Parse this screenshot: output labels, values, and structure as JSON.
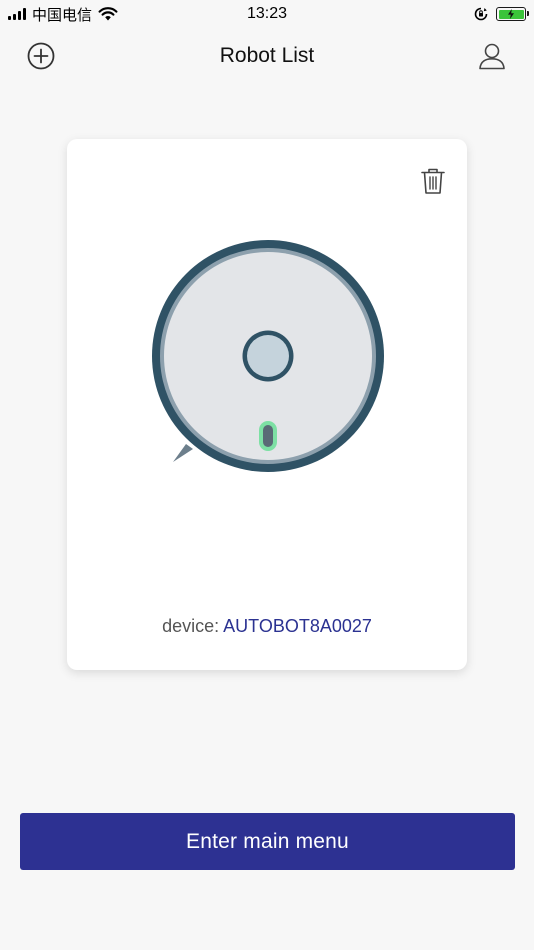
{
  "status_bar": {
    "carrier": "中国电信",
    "time": "13:23",
    "battery_color": "#3bc43a"
  },
  "nav": {
    "title": "Robot List",
    "add_icon": "plus-circle-icon",
    "profile_icon": "user-icon"
  },
  "robot_card": {
    "delete_icon": "trash-icon",
    "device_label": "device:",
    "device_id": "AUTOBOT8A0027",
    "device_id_color": "#2b3291"
  },
  "footer": {
    "enter_button_label": "Enter main menu",
    "button_color": "#2d3192"
  }
}
